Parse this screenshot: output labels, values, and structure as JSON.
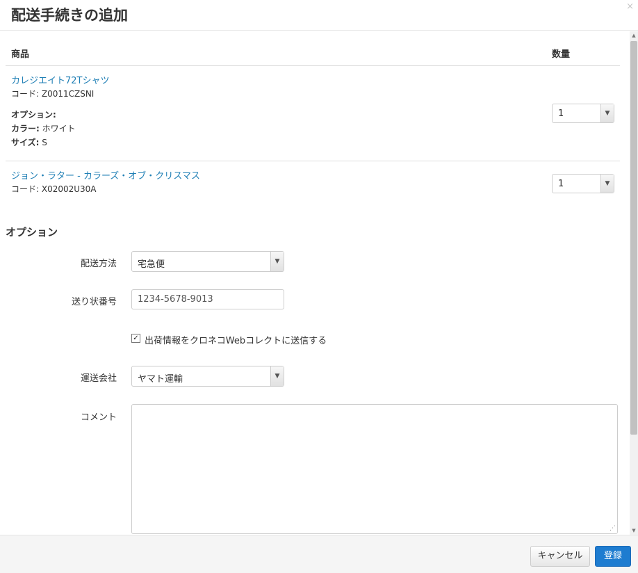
{
  "dialog": {
    "title": "配送手続きの追加",
    "close": "×"
  },
  "table": {
    "headers": {
      "product": "商品",
      "quantity": "数量"
    },
    "items": [
      {
        "name": "カレジエイト72Tシャツ",
        "code": "コード: Z0011CZSNI",
        "options_label": "オプション:",
        "options": [
          {
            "label": "カラー:",
            "value": "ホワイト"
          },
          {
            "label": "サイズ:",
            "value": "S"
          }
        ],
        "qty": "1"
      },
      {
        "name": "ジョン・ラター - カラーズ・オブ・クリスマス",
        "code": "コード: X02002U30A",
        "qty": "1"
      }
    ]
  },
  "options": {
    "title": "オプション",
    "shipping_method": {
      "label": "配送方法",
      "value": "宅急便"
    },
    "tracking_number": {
      "label": "送り状番号",
      "value": "1234-5678-9013"
    },
    "send_checkbox": {
      "label": "出荷情報をクロネコWebコレクトに送信する",
      "checked": true,
      "mark": "✓"
    },
    "carrier": {
      "label": "運送会社",
      "value": "ヤマト運輸"
    },
    "comment": {
      "label": "コメント",
      "value": ""
    }
  },
  "footer": {
    "cancel": "キャンセル",
    "submit": "登録"
  }
}
